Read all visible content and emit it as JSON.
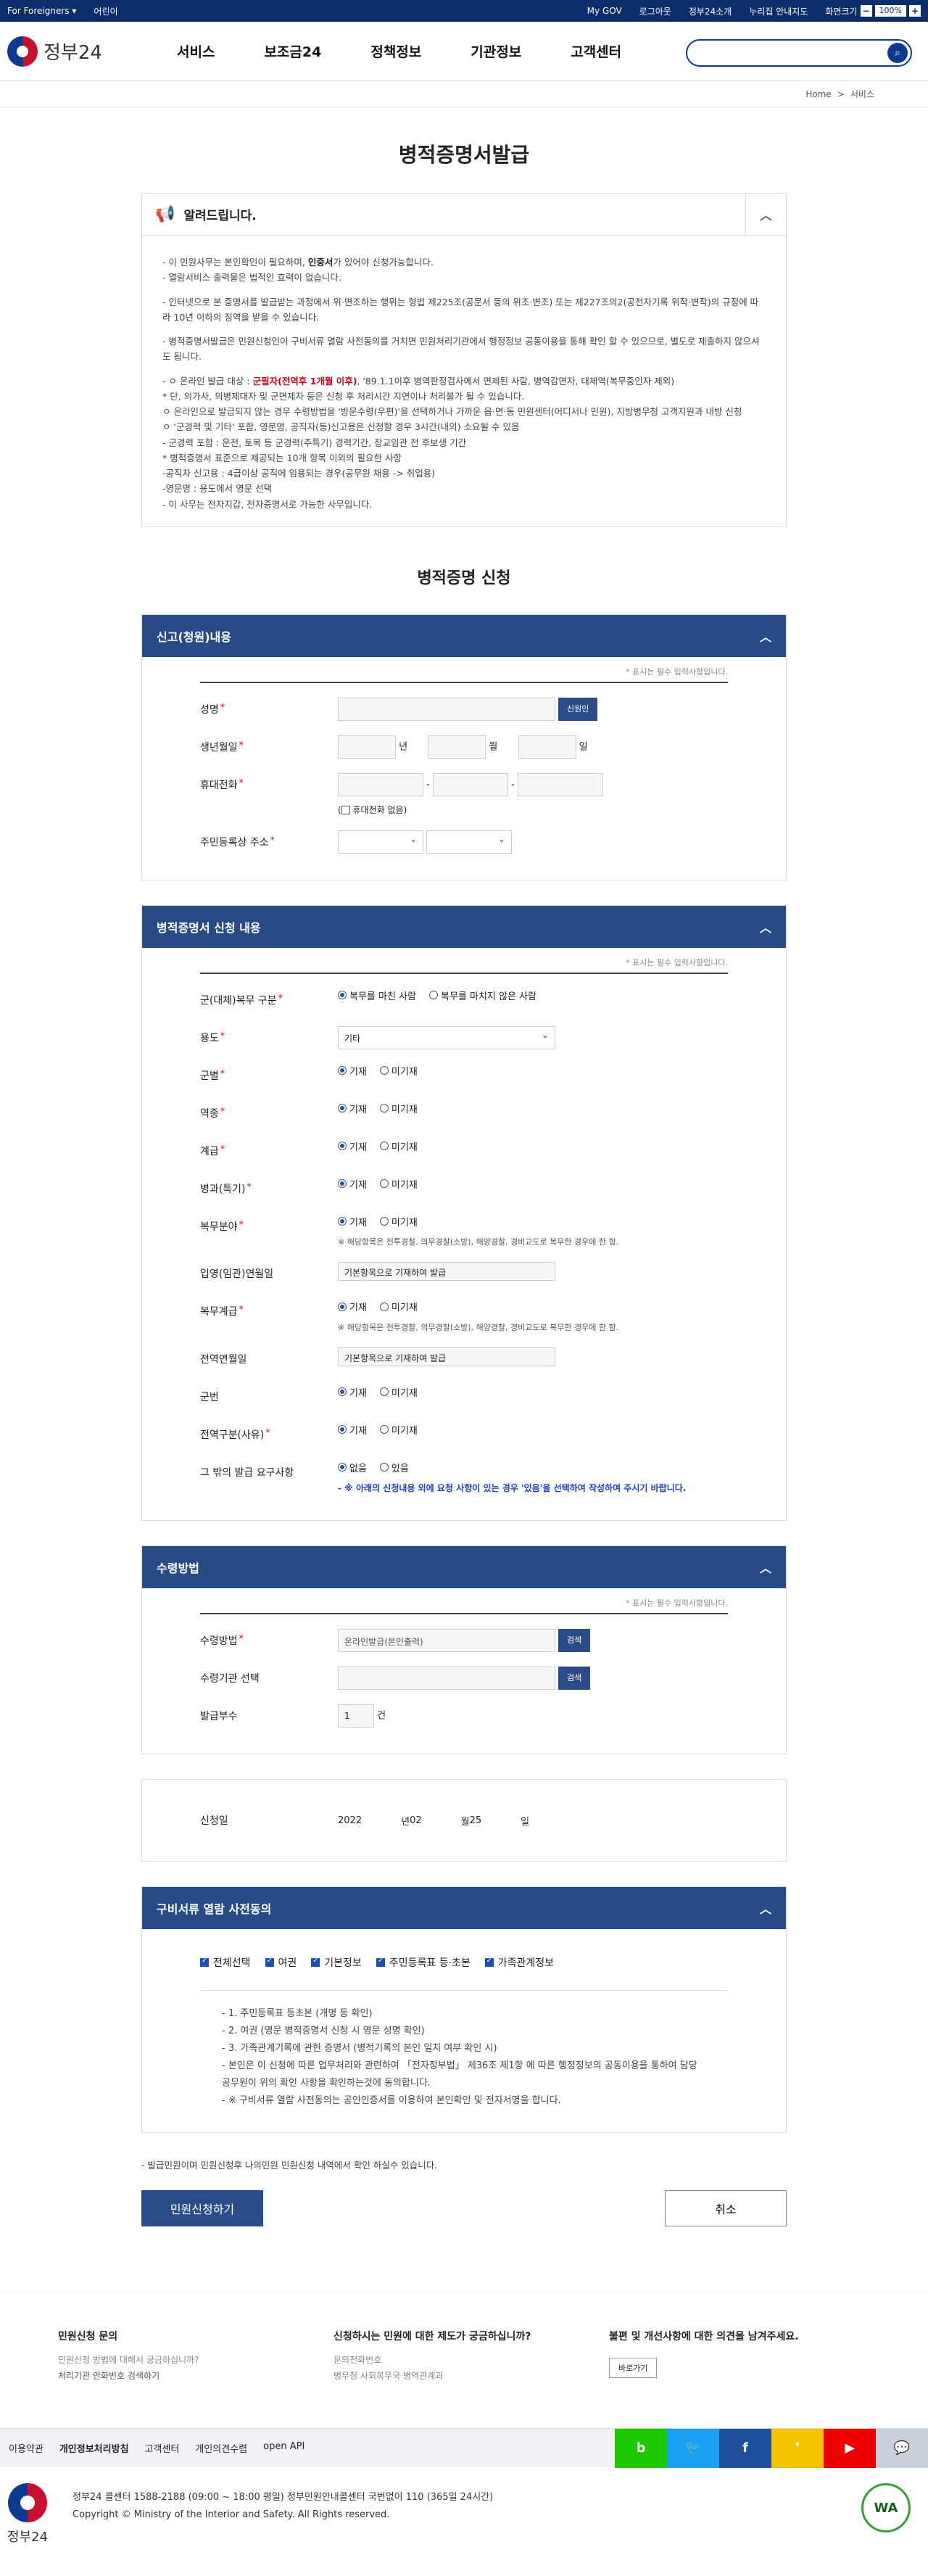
{
  "topbar": {
    "foreigners": "For Foreigners",
    "kids": "어린이",
    "mygov": "My GOV",
    "logout": "로그아웃",
    "about": "정부24소개",
    "map": "누리집 안내지도",
    "zoom_label": "화면크기",
    "zoom": "100%"
  },
  "header": {
    "logo": "정부24",
    "nav": [
      "서비스",
      "보조금24",
      "정책정보",
      "기관정보",
      "고객센터"
    ]
  },
  "crumbs": {
    "home": "Home",
    "sep": ">",
    "cur": "서비스"
  },
  "page": {
    "title": "병적증명서발급",
    "notice_title": "알려드립니다.",
    "apply_title": "병적증명 신청"
  },
  "notice": [
    "- 이 민원사무는 본인확인이 필요하며, 인증서가 있어야 신청가능합니다.",
    "- 열람서비스 출력물은 법적인 효력이 없습니다.",
    "- 인터넷으로 본 증명서를 발급받는 과정에서 위·변조하는 행위는 형법 제225조(공문서 등의 위조·변조) 또는 제227조의2(공전자기록 위작·변작)의 규정에 따라 10년 이하의 징역을 받을 수 있습니다.",
    "- 병적증명서발급은 민원신청인이 구비서류 열람 사전동의를 거치면 민원처리기관에서 행정정보 공동이용을 통해 확인 할 수 있으므로, 별도로 제출하지 않으셔도 됩니다.",
    "- ㅇ 온라인 발급 대상 : 군필자(전역후 1개월 이후), '89.1.1이후 병역판정검사에서 면제된 사람, 병역감면자, 대체역(복무중인자 제외)",
    "* 단, 의가사, 의병제대자 및 군면제자 등은 신청 후 처리시간 지연이나 처리불가 될 수 있습니다.",
    "ㅇ 온라인으로 발급되지 않는 경우 수령방법을 '방문수령(우편)'을 선택하거나 가까운 읍·면·동 민원센터(어디서나 민원), 지방병무청 고객지원과 내방 신청",
    "ㅇ '군경력 및 기타' 포함, 영문명, 공직자(등)신고용은 신청할 경우 3시간(내외) 소요될 수 있음",
    "- 군경력 포함 : 운전, 토목 등 군경력(주특기) 경력기간, 장교임관 전 후보생 기간",
    "* 병적증명서 표준으로 제공되는 10개 항목 이외의 필요한 사항",
    "-공직자 신고용 : 4급이상 공직에 임용되는 경우(공무원 채용 -> 취업용)",
    "-영문명 : 용도에서 영문 선택",
    "- 이 사무는 전자지갑, 전자증명서로 가능한 사무입니다."
  ],
  "notice_hl": {
    "cert": "인증서",
    "target": "군필자(전역후 1개월 이후)"
  },
  "req_note": "* 표시는 필수 입력사항입니다.",
  "s1": {
    "title": "신고(청원)내용",
    "name": "성명",
    "verify": "신원인",
    "birth": "생년월일",
    "y": "년",
    "m": "월",
    "d": "일",
    "phone": "휴대전화",
    "dash": "-",
    "nophone": "휴대전화 없음",
    "addr": "주민등록상 주소"
  },
  "s2": {
    "title": "병적증명서 신청 내용",
    "rows": [
      {
        "label": "군(대체)복무 구분",
        "opts": [
          "복무를 마친 사람",
          "복무를 마치지 않은 사람"
        ]
      },
      {
        "label": "용도",
        "select": "기타"
      },
      {
        "label": "군별",
        "opts": [
          "기재",
          "미기재"
        ]
      },
      {
        "label": "역종",
        "opts": [
          "기재",
          "미기재"
        ]
      },
      {
        "label": "계급",
        "opts": [
          "기재",
          "미기재"
        ]
      },
      {
        "label": "병과(특기)",
        "opts": [
          "기재",
          "미기재"
        ]
      },
      {
        "label": "복무분야",
        "opts": [
          "기재",
          "미기재"
        ],
        "note": "※ 해당항목은 전투경찰, 의무경찰(소방), 해양경찰, 경비교도로 복무한 경우에 한 함."
      },
      {
        "label": "입영(임관)연월일",
        "text": "기본항목으로 기재하여 발급"
      },
      {
        "label": "복무계급",
        "opts": [
          "기재",
          "미기재"
        ],
        "note": "※ 해당항목은 전투경찰, 의무경찰(소방), 해양경찰, 경비교도로 복무한 경우에 한 함."
      },
      {
        "label": "전역연월일",
        "text": "기본항목으로 기재하여 발급"
      },
      {
        "label": "군번",
        "opts": [
          "기재",
          "미기재"
        ]
      },
      {
        "label": "전역구분(사유)",
        "opts": [
          "기재",
          "미기재"
        ]
      },
      {
        "label": "그 밖의 발급 요구사항",
        "opts": [
          "없음",
          "있음"
        ],
        "note": "- ※ 아래의 신청내용 외에 요청 사항이 있는 경우 '있음'을 선택하여 작성하여 주시기 바랍니다."
      }
    ]
  },
  "s3": {
    "title": "수령방법",
    "method_label": "수령방법",
    "method_value": "온라인발급(본인출력)",
    "search": "검색",
    "org_label": "수령기관 선택",
    "copies_label": "발급부수",
    "copies": "1",
    "copies_unit": "건"
  },
  "date": {
    "label": "신청일",
    "year": "2022",
    "y": "년",
    "month": "02",
    "m": "월",
    "day": "25",
    "d": "일"
  },
  "s4": {
    "title": "구비서류 열람 사전동의",
    "checks": [
      "전체선택",
      "여권",
      "기본정보",
      "주민등록표 등·초본",
      "가족관계정보"
    ],
    "items": [
      "- 1. 주민등록표 등초본 (개명 등 확인)",
      "- 2. 여권 (영문 병적증명서 신청 시 영문 성명 확인)",
      "- 3. 가족관계기록에 관한 증명서 (병적기록의 본인 일치 여부 확인 시)",
      "- 본인은 이 신청에 따른 업무처리와 관련하여 「전자정부법」 제36조 제1항 에 따른 행정정보의 공동이용을 통하여 담당 공무원이 위의 확인 사항을 확인하는것에 동의합니다.",
      "- ※ 구비서류 열람 사전동의는 공인인증서를 이용하여 본인확인 및 전자서명을 합니다."
    ]
  },
  "foot_note": "- 발급민원이며 민원신청후 나의민원 민원신청 내역에서 확인 하실수 있습니다.",
  "actions": {
    "submit": "민원신청하기",
    "cancel": "취소"
  },
  "help": [
    {
      "title": "민원신청 문의",
      "lines": [
        "민원신청 방법에 대해서 궁금하십니까?",
        "처리기관 안화번호 검색하기"
      ]
    },
    {
      "title": "신청하시는 민원에 대한 제도가 궁금하십니까?",
      "lines": [
        "문의전화번호",
        "병무청 사회복무국 병역관계과"
      ]
    },
    {
      "title": "불편 및 개선사항에 대한 의견을 남겨주세요.",
      "btn": "바로가기"
    }
  ],
  "fnav": {
    "links": [
      "이용약관",
      "개인정보처리방침",
      "고객센터",
      "개인의견수렴",
      "open API"
    ]
  },
  "socials": [
    {
      "name": "blog-icon",
      "ch": "b",
      "color": "#1ec800"
    },
    {
      "name": "twitter-icon",
      "ch": "🐦",
      "color": "#1da1f2"
    },
    {
      "name": "facebook-icon",
      "ch": "f",
      "color": "#1b4e9b"
    },
    {
      "name": "kakao-icon",
      "ch": "❜",
      "color": "#f5c400"
    },
    {
      "name": "youtube-icon",
      "ch": "▶",
      "color": "#e00"
    },
    {
      "name": "chat-icon",
      "ch": "💬",
      "color": "#c8cfd8"
    }
  ],
  "fbot": {
    "logo": "정부24",
    "l1": "정부24 콜센터 1588-2188 (09:00 ~ 18:00 평일) 정부민원안내콜센터 국번없이 110 (365일 24시간)",
    "l2": "Copyright © Ministry of the Interior and Safety. All Rights reserved.",
    "wa": "WA"
  }
}
